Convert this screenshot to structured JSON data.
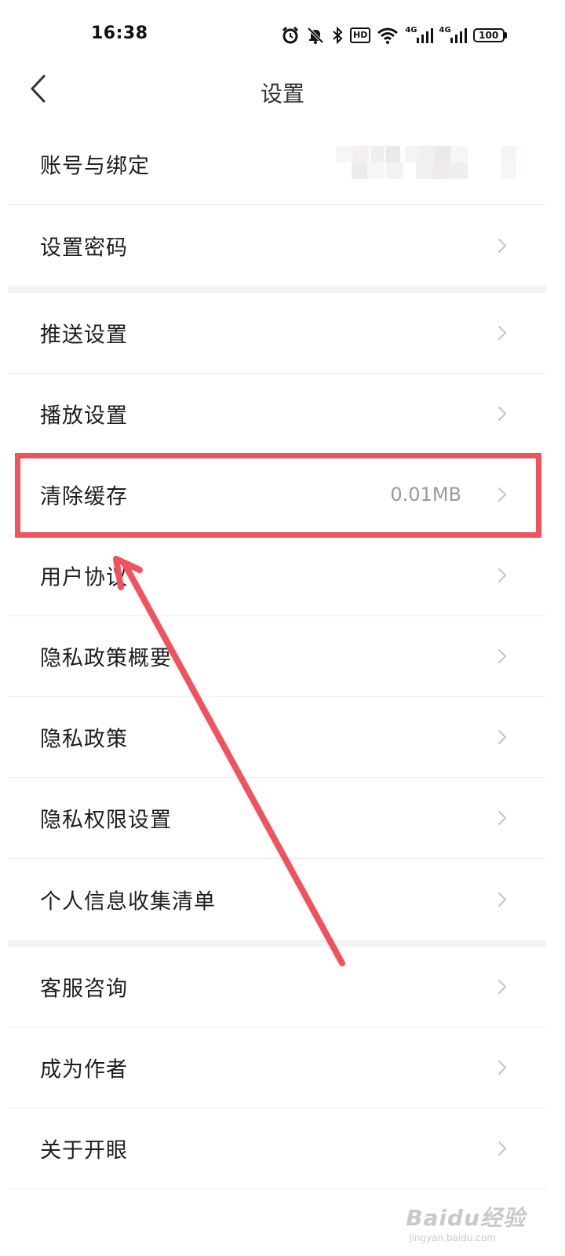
{
  "status_bar": {
    "time": "16:38",
    "icons": [
      "alarm-icon",
      "bell-muted-icon",
      "bluetooth-icon",
      "hd-voice-icon",
      "wifi-icon",
      "4g-signal-icon",
      "4g-signal-icon",
      "battery-icon"
    ],
    "hd_label": "HD",
    "network_1": "4G",
    "network_2": "4G",
    "battery_level": "100"
  },
  "header": {
    "title": "设置",
    "back_icon": "chevron-left-icon"
  },
  "settings": {
    "account": {
      "label": "账号与绑定"
    },
    "password": {
      "label": "设置密码"
    },
    "push": {
      "label": "推送设置"
    },
    "playback": {
      "label": "播放设置"
    },
    "clear_cache": {
      "label": "清除缓存",
      "value": "0.01MB"
    },
    "user_agreement": {
      "label": "用户协议"
    },
    "privacy_summary": {
      "label": "隐私政策概要"
    },
    "privacy_policy": {
      "label": "隐私政策"
    },
    "privacy_permissions": {
      "label": "隐私权限设置"
    },
    "personal_info": {
      "label": "个人信息收集清单"
    },
    "support": {
      "label": "客服咨询"
    },
    "become_author": {
      "label": "成为作者"
    },
    "about": {
      "label": "关于开眼"
    }
  },
  "annotation": {
    "highlight_color": "#f1525b"
  },
  "watermark": {
    "main": "Baidu经验",
    "sub": "jingyan.baidu.com"
  },
  "colors": {
    "background": "#ffffff",
    "separator": "#eeeeee",
    "group_gap": "#f3f3f3",
    "text": "#1e1e1e",
    "secondary_text": "#9a9a9a"
  }
}
